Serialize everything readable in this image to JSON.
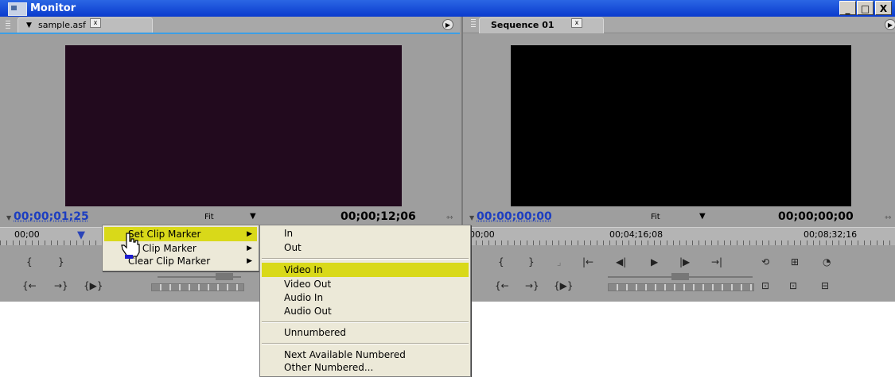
{
  "window": {
    "title": "Monitor",
    "btn_minimize": "_",
    "btn_maximize": "□",
    "btn_close": "X"
  },
  "source_panel": {
    "tab_label": "sample.asf",
    "tab_close": "x",
    "current_timecode": "00;00;01;25",
    "zoom": "Fit",
    "duration_timecode": "00;00;12;06",
    "ruler_start": "00;00"
  },
  "program_panel": {
    "tab_label": "Sequence 01",
    "tab_close": "x",
    "current_timecode": "00;00;00;00",
    "zoom": "Fit",
    "duration_timecode": "00;00;00;00",
    "ruler_labels": [
      "00;00",
      "00;04;16;08",
      "00;08;32;16"
    ]
  },
  "context_menu": {
    "items": [
      {
        "label": "Set Clip Marker",
        "submenu": true,
        "highlighted": true
      },
      {
        "label": "to Clip Marker",
        "submenu": true,
        "highlighted": false
      },
      {
        "label": "Clear Clip Marker",
        "submenu": true,
        "highlighted": false
      }
    ]
  },
  "submenu": {
    "group1": [
      "In",
      "Out"
    ],
    "group2": [
      "Video In",
      "Video Out",
      "Audio In",
      "Audio Out"
    ],
    "group3": [
      "Unnumbered"
    ],
    "group4": [
      "Next Available Numbered",
      "Other Numbered..."
    ],
    "highlighted": "Video In"
  },
  "colors": {
    "titlebar": "#0a3bcd",
    "highlight": "#d9d919",
    "timecode_blue": "#1d3ec0",
    "panel_bg": "#9e9e9e",
    "source_video": "#220a1e",
    "program_video": "#000000"
  }
}
